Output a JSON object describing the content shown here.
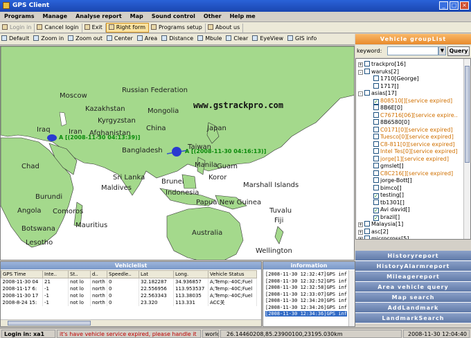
{
  "window": {
    "title": "GPS Client"
  },
  "menu": [
    "Programs",
    "Manage",
    "Analyse report",
    "Map",
    "Sound control",
    "Other",
    "Help me"
  ],
  "toolbar": [
    "Login in",
    "Cancel login",
    "Exit",
    "Right form",
    "Programs setup",
    "About us"
  ],
  "maptools": [
    "Default",
    "Zoom in",
    "Zoom out",
    "Center",
    "Area",
    "Distance",
    "Mbule",
    "Clear",
    "EyeView",
    "GIS info"
  ],
  "map": {
    "watermark": "www.gstrackpro.com",
    "labels": [
      "Moscow",
      "Russian Federation",
      "Kazakhstan",
      "Mongolia",
      "Kyrgyzstan",
      "China",
      "Japan",
      "Bangladesh",
      "Sri Lanka",
      "Maldives",
      "Brunei",
      "Manila",
      "Guam",
      "Koror",
      "Marshall Islands",
      "Papua New Guinea",
      "Tuvalu",
      "Fiji",
      "Australia",
      "Wellington",
      "Burundi",
      "Comoros",
      "Mauritius",
      "Angola",
      "Botswana",
      "Lesotho",
      "Chad",
      "Iraq",
      "Iran",
      "Afghanistan",
      "Taiwan",
      "Indonesia"
    ],
    "vehicle1": "A [(2008-11-30 04:13:39)]",
    "vehicle2": "A [(2008-11-30 04:16:13)]"
  },
  "groups": {
    "title": "Vehicle groupList",
    "keyword_label": "keyword:",
    "keyword_value": "",
    "query": "Query",
    "tree": [
      {
        "text": "trackpro[16]",
        "level": 0,
        "ex": "+",
        "cb": false
      },
      {
        "text": "waruks[2]",
        "level": 0,
        "ex": "-",
        "cb": false
      },
      {
        "text": "1710[George]",
        "level": 1,
        "cb": false
      },
      {
        "text": "1717[]",
        "level": 1,
        "cb": false
      },
      {
        "text": "asias[17]",
        "level": 0,
        "ex": "-",
        "cb": false
      },
      {
        "text": "808510[][service expired]",
        "level": 1,
        "cb": true,
        "expired": true
      },
      {
        "text": "8B6E[0]",
        "level": 1,
        "cb": false
      },
      {
        "text": "C76716[06][service expire..",
        "level": 1,
        "cb": false,
        "expired": true
      },
      {
        "text": "8B6580[0]",
        "level": 1,
        "cb": false
      },
      {
        "text": "C0171[0][service expired]",
        "level": 1,
        "cb": false,
        "expired": true
      },
      {
        "text": "Tuesco[0][service expired]",
        "level": 1,
        "cb": false,
        "expired": true
      },
      {
        "text": "C8-811[0][service expired]",
        "level": 1,
        "cb": false,
        "expired": true
      },
      {
        "text": "Intel Tes[0][service expired]",
        "level": 1,
        "cb": false,
        "expired": true
      },
      {
        "text": "jorge[1][service expired]",
        "level": 1,
        "cb": false,
        "expired": true
      },
      {
        "text": "gmslet[]",
        "level": 1,
        "cb": false
      },
      {
        "text": "C8C216[][service expired]",
        "level": 1,
        "cb": false,
        "expired": true
      },
      {
        "text": "jorge-Bott[]",
        "level": 1,
        "cb": false
      },
      {
        "text": "bimco[]",
        "level": 1,
        "cb": false
      },
      {
        "text": "testing[]",
        "level": 1,
        "cb": true
      },
      {
        "text": "tb1301[]",
        "level": 1,
        "cb": false
      },
      {
        "text": "Avi david[]",
        "level": 1,
        "cb": true
      },
      {
        "text": "brazil[]",
        "level": 1,
        "cb": true
      },
      {
        "text": "Malaysia[1]",
        "level": 0,
        "ex": "+",
        "cb": false
      },
      {
        "text": "asc[2]",
        "level": 0,
        "ex": "+",
        "cb": false
      },
      {
        "text": "microcross[5]",
        "level": 0,
        "ex": "+",
        "cb": false
      }
    ]
  },
  "nav": [
    "Historyreport",
    "HistoryAlarmreport",
    "Mileagereport",
    "Area vehicle query",
    "Map search",
    "AddLandmark",
    "LandmarkSearch"
  ],
  "vehiclelist": {
    "title": "Vehiclelist",
    "columns": [
      "GPS Time",
      "Inte..",
      "St..",
      "d..",
      "Speedle..",
      "Lat",
      "Long.",
      "Vehicle Status"
    ],
    "rows": [
      [
        "2008-11-30 04",
        "21",
        "not lo",
        "north",
        "0",
        "32.182287",
        "34.936857",
        "A;Temp:-40C;Fuel"
      ],
      [
        "2008-11-17 6:",
        "-1",
        "not lo",
        "north",
        "0",
        "22.556956",
        "113.953537",
        "A;Temp:-40C;Fuel"
      ],
      [
        "2008-11-30 17",
        "-1",
        "not lo",
        "north",
        "0",
        "22.563343",
        "113.38035",
        "A;Temp:-40C;Fuel"
      ],
      [
        "2008-8-24 15:",
        "-1",
        "not lo",
        "north",
        "0",
        "23.320",
        "113.331",
        "ACC关"
      ]
    ]
  },
  "information": {
    "title": "information",
    "rows": [
      "[2008-11-30 12:32:47]GPS info",
      "[2008-11-30 12:32:52]GPS info",
      "[2008-11-30 12:32:58]GPS info",
      "[2008-11-30 12:33:07]GPS info",
      "[2008-11-30 12:34:20]GPS info",
      "[2008-11-30 12:34:26]GPS info",
      "[2008-11-30 12:34:36]GPS info"
    ]
  },
  "status": {
    "login": "Login in: xa1",
    "msg": "it's have vehicle service expired, please handle it",
    "world": "world",
    "coord": "26.14460208,85.23900100,23195.030km",
    "time": "2008-11-30 12:04:40"
  }
}
